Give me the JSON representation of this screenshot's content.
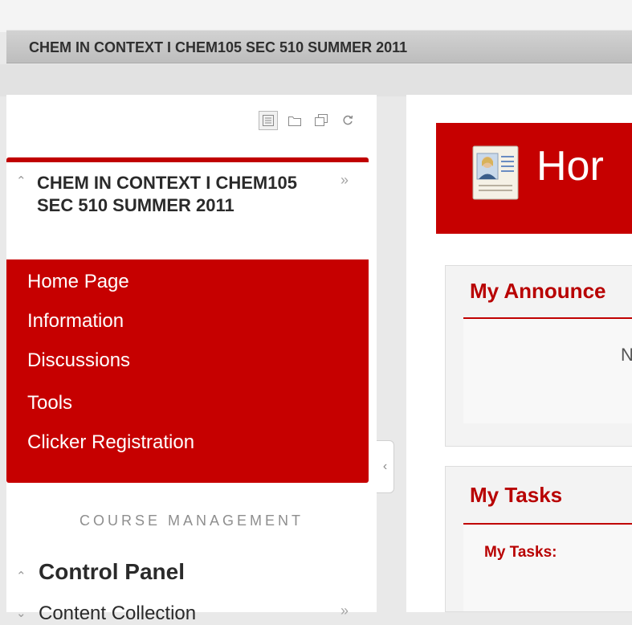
{
  "course_bar": {
    "title": "CHEM IN CONTEXT I CHEM105 SEC 510 SUMMER 2011"
  },
  "left_panel": {
    "view_icons": [
      "list-view-icon",
      "folder-view-icon",
      "window-view-icon",
      "refresh-icon"
    ],
    "course_title": "CHEM IN CONTEXT I CHEM105 SEC 510 SUMMER 2011",
    "menu": [
      {
        "label": "Home Page"
      },
      {
        "label": "Information"
      },
      {
        "label": "Discussions"
      },
      {
        "label": "Tools"
      },
      {
        "label": "Clicker Registration"
      }
    ],
    "course_management_heading": "COURSE MANAGEMENT",
    "control_panel_label": "Control Panel",
    "content_collection_label": "Content Collection"
  },
  "main": {
    "page_title": "Hor",
    "announcements": {
      "title": "My Announce",
      "body_fragment": "N"
    },
    "tasks": {
      "title": "My Tasks",
      "label": "My Tasks:"
    }
  },
  "colors": {
    "accent_red": "#c60000",
    "title_red": "#b80000",
    "course_bar_gray": "#c8c8c8"
  }
}
